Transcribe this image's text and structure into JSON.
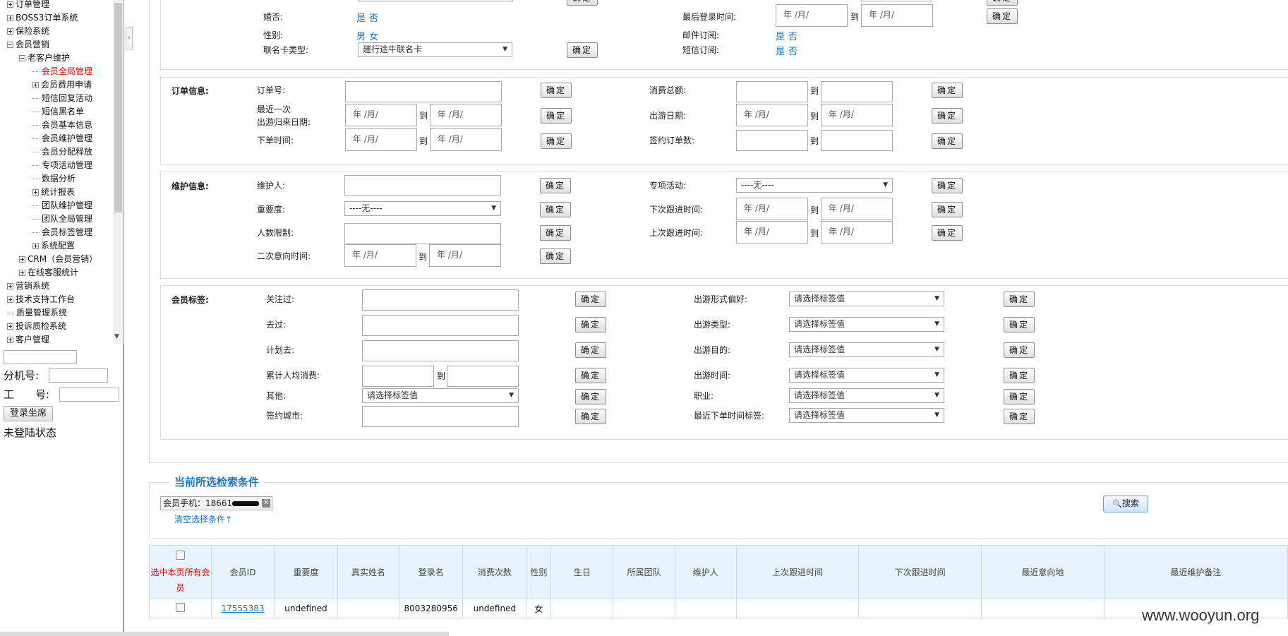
{
  "sidebar": {
    "items": [
      {
        "label": "订单管理",
        "icon": "plus"
      },
      {
        "label": "BOSS3订单系统",
        "icon": "plus"
      },
      {
        "label": "保险系统",
        "icon": "plus"
      },
      {
        "label": "会员营销",
        "icon": "minus"
      },
      {
        "label": "老客户维护",
        "icon": "minus"
      },
      {
        "label": "会员全局管理",
        "icon": "leaf"
      },
      {
        "label": "会员费用申请",
        "icon": "plus"
      },
      {
        "label": "短信回复活动",
        "icon": "leaf"
      },
      {
        "label": "短信黑名单",
        "icon": "leaf"
      },
      {
        "label": "会员基本信息",
        "icon": "leaf"
      },
      {
        "label": "会员维护管理",
        "icon": "leaf"
      },
      {
        "label": "会员分配释放",
        "icon": "leaf"
      },
      {
        "label": "专项活动管理",
        "icon": "leaf"
      },
      {
        "label": "数据分析",
        "icon": "leaf"
      },
      {
        "label": "统计报表",
        "icon": "plus"
      },
      {
        "label": "团队维护管理",
        "icon": "leaf"
      },
      {
        "label": "团队全局管理",
        "icon": "leaf"
      },
      {
        "label": "会员标签管理",
        "icon": "leaf"
      },
      {
        "label": "系统配置",
        "icon": "plus"
      },
      {
        "label": "CRM（会员营销）",
        "icon": "plus"
      },
      {
        "label": "在线客服统计",
        "icon": "plus"
      },
      {
        "label": "营销系统",
        "icon": "plus"
      },
      {
        "label": "技术支持工作台",
        "icon": "plus"
      },
      {
        "label": "质量管理系统",
        "icon": "leaf"
      },
      {
        "label": "投诉质检系统",
        "icon": "plus"
      },
      {
        "label": "客户管理",
        "icon": "plus"
      }
    ],
    "ext_label": "分机号:",
    "emp_label": "工　　号:",
    "login_btn": "登录坐席",
    "status": "未登陆状态"
  },
  "common": {
    "ok": "确定",
    "to": "到",
    "date_ph": "年 /月/",
    "none_opt": "----无----",
    "tag_ph": "请选择标签值",
    "yes": "是",
    "no": "否",
    "male": "男",
    "female": "女"
  },
  "basic": {
    "marital": "婚否:",
    "gender": "性别:",
    "card_type": "联名卡类型:",
    "card_value": "建行途牛联名卡",
    "last_login": "最后登录时间:",
    "email_sub": "邮件订阅:",
    "sms_sub": "短信订阅:"
  },
  "order": {
    "title": "订单信息:",
    "order_no": "订单号:",
    "last_trip_line1": "最近一次",
    "last_trip_line2": "出游归来日期:",
    "order_time": "下单时间:",
    "total_spend": "消费总额:",
    "trip_date": "出游日期:",
    "signed_count": "签约订单数:"
  },
  "maint": {
    "title": "维护信息:",
    "maintainer": "维护人:",
    "importance": "重要度:",
    "people_limit": "人数限制:",
    "second_intent": "二次意向时间:",
    "special_activity": "专项活动:",
    "next_follow": "下次跟进时间:",
    "last_follow": "上次跟进时间:"
  },
  "tags": {
    "title": "会员标签:",
    "follow": "关注过:",
    "been": "去过:",
    "plan": "计划去:",
    "avg_spend": "累计人均消费:",
    "other": "其他:",
    "signed_city": "签约城市:",
    "trip_form": "出游形式偏好:",
    "trip_type": "出游类型:",
    "trip_dest": "出游目的:",
    "trip_time": "出游时间:",
    "job": "职业:",
    "last_order_tag": "最近下单时间标签:"
  },
  "criteria": {
    "title": "当前所选检索条件",
    "chip": "会员手机：18661",
    "clear": "清空选择条件↑",
    "search": "搜索"
  },
  "table": {
    "headers": [
      "选中本页所有会员",
      "会员ID",
      "重要度",
      "真实姓名",
      "登录名",
      "消费次数",
      "性别",
      "生日",
      "所属团队",
      "维护人",
      "上次跟进时间",
      "下次跟进时间",
      "最近意向地",
      "最近维护备注"
    ],
    "rows": [
      {
        "id": "17555383",
        "importance": "undefined",
        "name": "",
        "login": "8003280956",
        "count": "undefined",
        "gender": "女",
        "birthday": "",
        "team": "",
        "maintainer": "",
        "last": "",
        "next": "",
        "dest": "",
        "note": ""
      }
    ]
  },
  "watermark": "www.wooyun.org"
}
